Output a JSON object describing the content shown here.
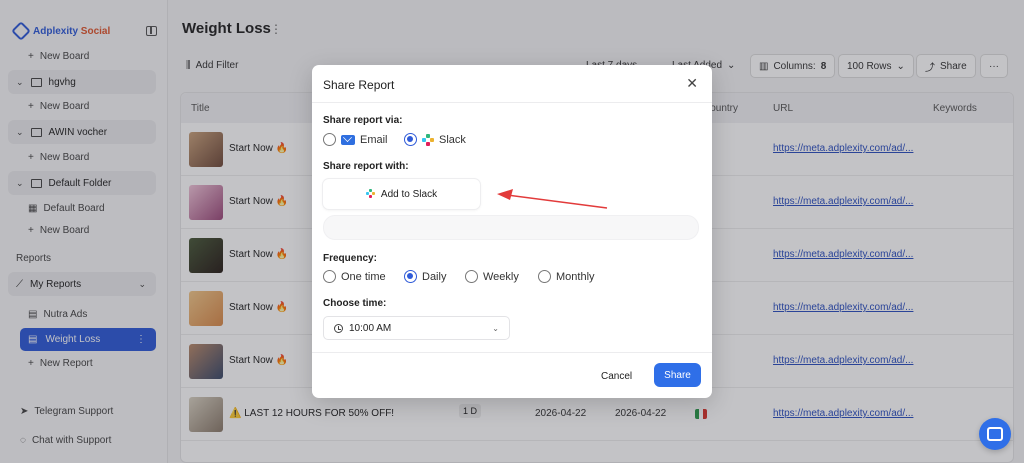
{
  "brand": {
    "name": "Adplexity",
    "name_accent": "Social"
  },
  "sidebar": {
    "items": [
      {
        "type": "sub",
        "label": "New Board"
      },
      {
        "type": "folder",
        "label": "hgvhg"
      },
      {
        "type": "sub",
        "label": "New Board"
      },
      {
        "type": "folder",
        "label": "AWIN vocher"
      },
      {
        "type": "sub",
        "label": "New Board"
      },
      {
        "type": "folder",
        "label": "Default Folder"
      },
      {
        "type": "sub",
        "label": "Default Board"
      },
      {
        "type": "sub",
        "label": "New Board"
      }
    ],
    "reports_heading": "Reports",
    "my_reports": "My Reports",
    "nutra_ads": "Nutra Ads",
    "weight_loss": "Weight Loss",
    "new_report": "New Report",
    "telegram": "Telegram Support",
    "chat_support": "Chat with Support"
  },
  "main": {
    "title": "Weight Loss",
    "add_filter": "Add Filter",
    "last_7_days": "Last 7 days",
    "last_added": "Last Added",
    "columns_label": "Columns:",
    "columns_count": "8",
    "rows": "100 Rows",
    "share": "Share",
    "more": "···",
    "headers": {
      "title": "Title",
      "country": "Country",
      "url": "URL",
      "keywords": "Keywords"
    },
    "rows_data": [
      {
        "title": "Start Now 🔥",
        "url": "https://meta.adplexity.com/ad/..."
      },
      {
        "title": "Start Now 🔥",
        "url": "https://meta.adplexity.com/ad/..."
      },
      {
        "title": "Start Now 🔥",
        "url": "https://meta.adplexity.com/ad/..."
      },
      {
        "title": "Start Now 🔥",
        "url": "https://meta.adplexity.com/ad/..."
      },
      {
        "title": "Start Now 🔥",
        "url": "https://meta.adplexity.com/ad/..."
      },
      {
        "title": "⚠️ LAST 12 HOURS FOR 50% OFF!",
        "badge": "1 D",
        "date1": "2026-04-22",
        "date2": "2026-04-22",
        "url": "https://meta.adplexity.com/ad/..."
      }
    ]
  },
  "modal": {
    "title": "Share Report",
    "via_label": "Share report via:",
    "email": "Email",
    "slack": "Slack",
    "with_label": "Share report with:",
    "add_to_slack": "Add to Slack",
    "frequency_label": "Frequency:",
    "freq": {
      "one_time": "One time",
      "daily": "Daily",
      "weekly": "Weekly",
      "monthly": "Monthly"
    },
    "choose_time_label": "Choose time:",
    "time_value": "10:00 AM",
    "cancel": "Cancel",
    "share": "Share"
  },
  "colors": {
    "accent": "#2f6fe8",
    "arrow": "#e23b3b",
    "slack_blue": "#36c5f0",
    "slack_green": "#2eb67d",
    "slack_yellow": "#ecb22e",
    "slack_red": "#e01e5a"
  }
}
